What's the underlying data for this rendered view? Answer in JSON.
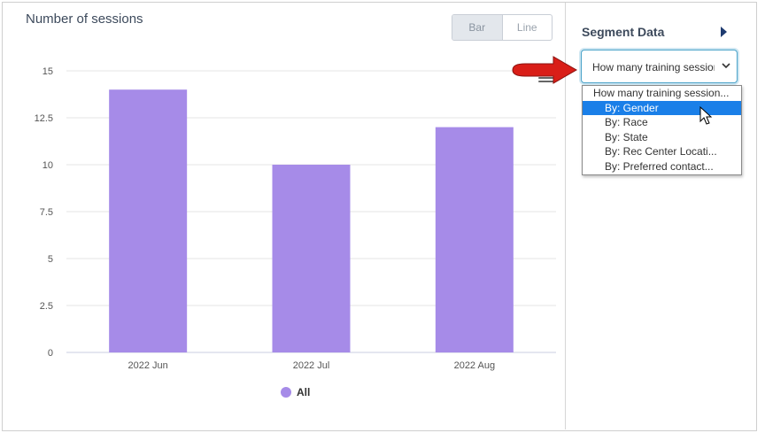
{
  "chart_panel": {
    "title": "Number of sessions",
    "toggle": {
      "bar_label": "Bar",
      "line_label": "Line",
      "active": "Bar"
    },
    "menu_icon": "hamburger-menu-icon"
  },
  "chart_data": {
    "type": "bar",
    "categories": [
      "2022 Jun",
      "2022 Jul",
      "2022 Aug"
    ],
    "series": [
      {
        "name": "All",
        "values": [
          14,
          10,
          12
        ],
        "color": "#a68be8"
      }
    ],
    "ylim": [
      0,
      15
    ],
    "yticks": [
      "0",
      "2.5",
      "5",
      "7.5",
      "10",
      "12.5",
      "15"
    ],
    "grid": true,
    "legend": "bottom-center"
  },
  "legend": {
    "label": "All",
    "color": "#a68be8"
  },
  "segment": {
    "title": "Segment Data",
    "select_value": "How many training sessions?",
    "options": [
      {
        "label": "How many training session...",
        "kind": "group"
      },
      {
        "label": "By: Gender",
        "kind": "sub",
        "selected": true
      },
      {
        "label": "By: Race",
        "kind": "sub"
      },
      {
        "label": "By: State",
        "kind": "sub"
      },
      {
        "label": "By: Rec Center Locati...",
        "kind": "sub"
      },
      {
        "label": "By: Preferred contact...",
        "kind": "sub"
      }
    ]
  },
  "colors": {
    "bar": "#a68be8",
    "accent": "#1a7fe8",
    "arrow": "#d91e18",
    "nav_arrow": "#1f3b70"
  }
}
